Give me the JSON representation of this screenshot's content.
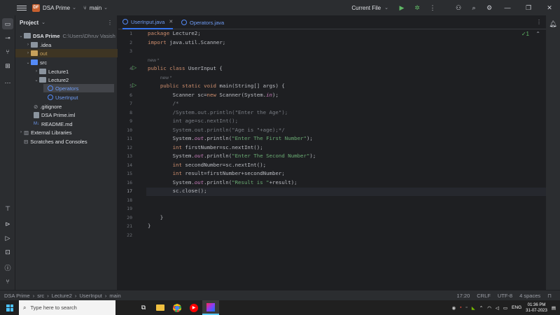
{
  "titlebar": {
    "project_badge": "DF",
    "project_name": "DSA Prime",
    "branch": "main",
    "run_config": "Current File"
  },
  "project_panel": {
    "title": "Project",
    "root_name": "DSA Prime",
    "root_path": "C:\\Users\\Dhruv Vasish",
    "items": {
      "idea": ".idea",
      "out": "out",
      "src": "src",
      "lecture1": "Lecture1",
      "lecture2": "Lecture2",
      "operators": "Operators",
      "userinput": "UserInput",
      "gitignore": ".gitignore",
      "iml": "DSA Prime.iml",
      "readme": "README.md",
      "ext_libs": "External Libraries",
      "scratches": "Scratches and Consoles"
    },
    "md_badge": "M↓"
  },
  "tabs": [
    {
      "label": "UserInput.java"
    },
    {
      "label": "Operators.java"
    }
  ],
  "editor": {
    "inspection_count": "1",
    "hint_new": "new *",
    "current_line": 17,
    "lines": [
      "package Lecture2;",
      "import java.util.Scanner;",
      "",
      "public class UserInput {",
      "    public static void main(String[] args) {",
      "        Scanner sc=new Scanner(System.in);",
      "        /*",
      "        /System.out.println(\"Enter the Age\");",
      "        int age=sc.nextInt();",
      "        System.out.println(\"Age is \"+age);*/",
      "        System.out.println(\"Enter The First Number\");",
      "        int firstNumber=sc.nextInt();",
      "        System.out.println(\"Enter The Second Number\");",
      "        int secondNumber=sc.nextInt();",
      "        int result=firstNumber+secondNumber;",
      "        System.out.println(\"Result is \"+result);",
      "        sc.close();",
      "",
      "",
      "    }",
      "}",
      ""
    ]
  },
  "statusbar": {
    "crumbs": [
      "DSA Prime",
      "src",
      "Lecture2",
      "UserInput",
      "main"
    ],
    "position": "17:20",
    "line_sep": "CRLF",
    "encoding": "UTF-8",
    "indent": "4 spaces"
  },
  "taskbar": {
    "search_placeholder": "Type here to search",
    "lang": "ENG",
    "time": "01:36 PM",
    "date": "31-07-2023"
  }
}
